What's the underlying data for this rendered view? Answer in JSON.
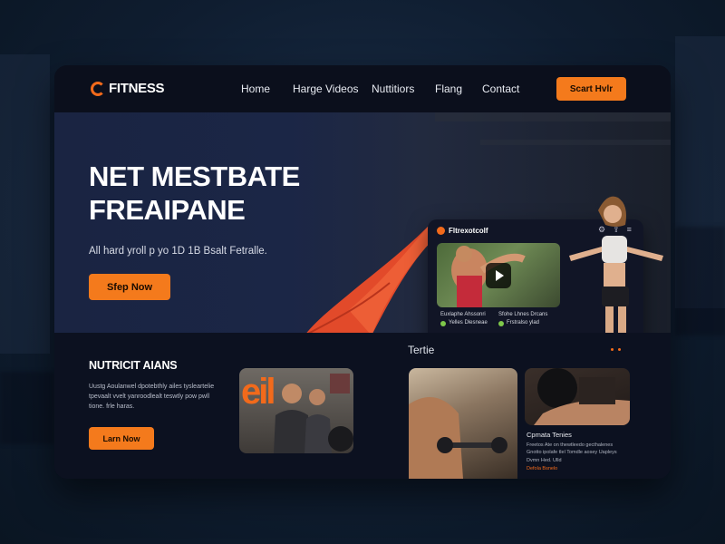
{
  "brand": {
    "name": "FITNESS",
    "accent": "#f47a1c",
    "bg": "#0c1120"
  },
  "nav": {
    "links": [
      "Home",
      "Harge Videos",
      "Nuttitiors",
      "Flang",
      "Contact"
    ],
    "cta": "Scart Hvlr"
  },
  "hero": {
    "title_line1": "NET MESTBATE",
    "title_line2": "FREAIPANE",
    "subtitle": "All hard yroll p yo 1D 1B Bsalt Fetralle.",
    "cta": "Sfep Now"
  },
  "video_card": {
    "title": "Fltrexotcolf",
    "icons": [
      "settings-icon",
      "share-icon",
      "menu-icon"
    ],
    "meta_left_title": "Euxlaphe Ahssonri",
    "meta_left_sub": "Yelles  Dlesneae",
    "meta_right_title": "Sfohe Lhnes Drcans",
    "meta_right_sub": "Frstralso ylad"
  },
  "nutrition": {
    "title": "NUTRICIT AIANS",
    "body": "Uustg Aoulanwel dpotebthly ailes tysleartelie tpevaalt vvelt yanroodlealt teswtly pow pwll tione. frle haras.",
    "cta": "Larn Now",
    "photo_letters": "eil"
  },
  "trending": {
    "title": "Tertie",
    "card2_title": "Cpmata Tenies",
    "card2_body": "Freetos Ate on thewtleedo gecthalenes Gnotto ipolafe tlel Tomdle aosey Uapleys Dvmn Hed. Ulld",
    "card2_link": "Defola  Bsnelo"
  }
}
